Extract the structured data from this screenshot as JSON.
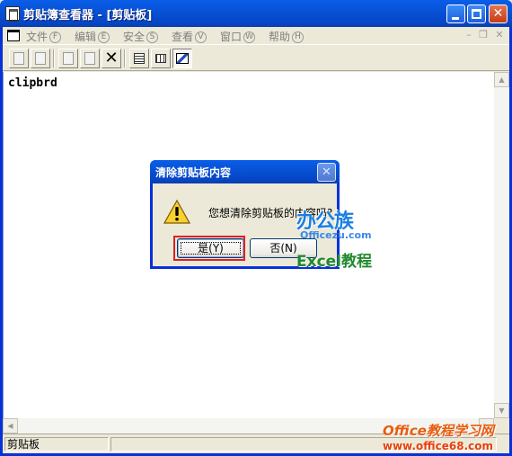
{
  "window": {
    "title": "剪贴簿查看器 - [剪贴板]",
    "title_bar_color": "#0a5ee8"
  },
  "menu": {
    "items": [
      {
        "label": "文件",
        "hot": "F"
      },
      {
        "label": "编辑",
        "hot": "E"
      },
      {
        "label": "安全",
        "hot": "S"
      },
      {
        "label": "查看",
        "hot": "V"
      },
      {
        "label": "窗口",
        "hot": "W"
      },
      {
        "label": "帮助",
        "hot": "H"
      }
    ]
  },
  "content": {
    "text": "clipbrd"
  },
  "status": {
    "left": "剪贴板"
  },
  "dialog": {
    "title": "清除剪贴板内容",
    "message": "您想清除剪贴板的内容吗?",
    "yes_label": "是(Y)",
    "no_label": "否(N)",
    "close_symbol": "✕"
  },
  "watermark": {
    "logo": "办公族",
    "site": "Officezu.com",
    "excel": "Excel教程",
    "bottom_line1": "Office教程学习网",
    "bottom_line2": "www.office68.com"
  },
  "colors": {
    "accent": "#0831d9",
    "highlight": "#e02020",
    "watermark_green": "#1f8a2e",
    "watermark_orange": "#e85c10"
  }
}
